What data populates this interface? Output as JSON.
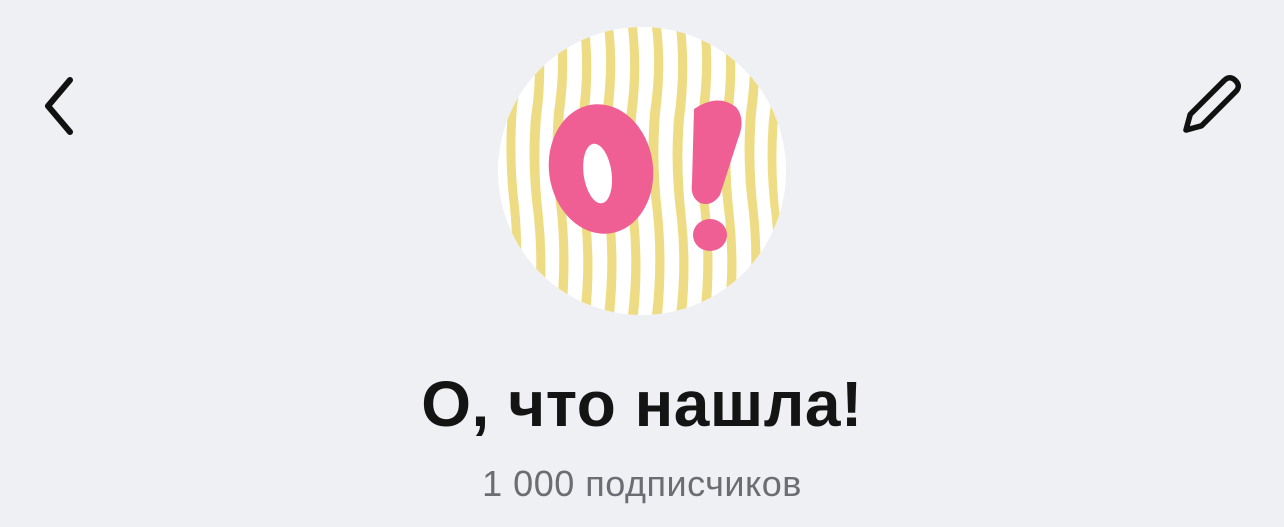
{
  "header": {
    "back_icon": "chevron-left-icon",
    "edit_icon": "pencil-icon"
  },
  "channel": {
    "title": "О, что нашла!",
    "subscribers": "1 000 подписчиков",
    "avatar": {
      "logo_text": "O!",
      "background_color": "#ffffff",
      "stripe_color": "#edd978",
      "logo_color": "#ef5f93"
    }
  }
}
